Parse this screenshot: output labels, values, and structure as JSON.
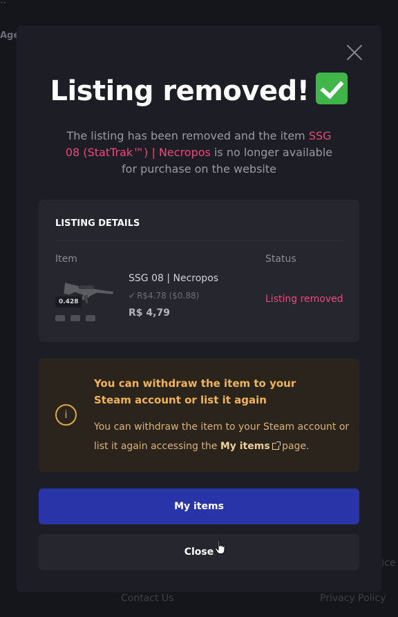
{
  "background": {
    "top_fragment": "..",
    "age_label": "Age",
    "contact_link": "Contact Us",
    "privacy_link": "Privacy Policy",
    "service_fragment": "vice"
  },
  "modal": {
    "title": "Listing removed!",
    "title_emoji_icon": "check-mark-button-icon",
    "description": {
      "before": "The listing has been removed and the item ",
      "item_name": "SSG 08 (StatTrak™) | Necropos",
      "after": " is no longer available for purchase on the website"
    },
    "details": {
      "heading": "LISTING DETAILS",
      "col_item": "Item",
      "col_status": "Status",
      "item": {
        "float": "0.428",
        "name": "SSG 08 | Necropos",
        "secondary_price": "R$4.78 ($0.88)",
        "price": "R$ 4,79",
        "sticker_count": 3
      },
      "status": "Listing removed"
    },
    "info": {
      "title": "You can withdraw the item to your Steam account or list it again",
      "body_before": "You can withdraw the item to your Steam account or list it again accessing the ",
      "link": "My items",
      "body_after": " page.",
      "icon": "info-icon"
    },
    "primary_button": "My items",
    "secondary_button": "Close"
  },
  "colors": {
    "accent_pink": "#ea4a7a",
    "primary_button": "#2834a8",
    "info_gold": "#efb35a",
    "success_green": "#3fb54a"
  }
}
